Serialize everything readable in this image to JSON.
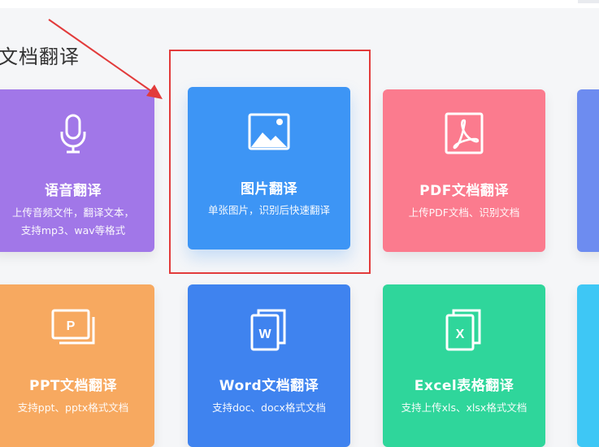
{
  "section": {
    "title": "文档翻译"
  },
  "cards": [
    {
      "title": "语音翻译",
      "desc": [
        "上传音频文件，翻译文本，",
        "支持mp3、wav等格式"
      ],
      "icon": "microphone-icon"
    },
    {
      "title": "图片翻译",
      "desc": [
        "单张图片，识别后快速翻译"
      ],
      "icon": "image-icon"
    },
    {
      "title": "PDF文档翻译",
      "desc": [
        "上传PDF文档、识别文档"
      ],
      "icon": "pdf-icon"
    },
    {
      "title": "PPT文档翻译",
      "desc": [
        "支持ppt、pptx格式文档"
      ],
      "icon": "ppt-icon"
    },
    {
      "title": "Word文档翻译",
      "desc": [
        "支持doc、docx格式文档"
      ],
      "icon": "word-icon"
    },
    {
      "title": "Excel表格翻译",
      "desc": [
        "支持上传xls、xlsx格式文档"
      ],
      "icon": "excel-icon"
    }
  ],
  "colors": {
    "voice": "#a177e8",
    "image": "#3d95f5",
    "pdf": "#fb7b8e",
    "ppt": "#f7a960",
    "word": "#3f83ef",
    "excel": "#2fd69b",
    "highlight": "#e23b3b"
  }
}
